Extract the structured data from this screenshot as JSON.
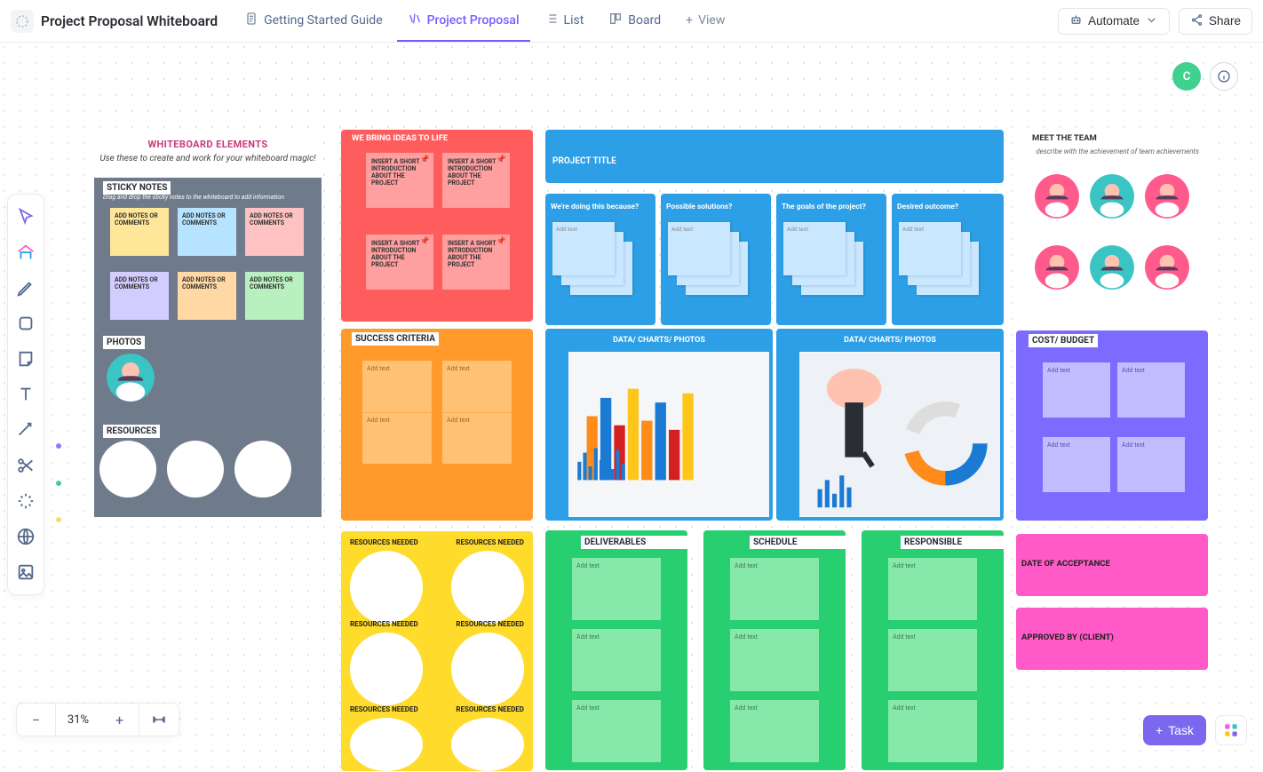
{
  "header": {
    "title": "Project Proposal Whiteboard",
    "tabs": [
      {
        "icon": "doc",
        "label": "Getting Started Guide"
      },
      {
        "icon": "wb",
        "label": "Project Proposal",
        "active": true
      },
      {
        "icon": "list",
        "label": "List"
      },
      {
        "icon": "board",
        "label": "Board"
      }
    ],
    "add_view": "View",
    "automate": "Automate",
    "share": "Share"
  },
  "presence": {
    "user_initial": "C"
  },
  "zoom": {
    "value": "31%"
  },
  "task_button": "Task",
  "elements_panel": {
    "title": "WHITEBOARD ELEMENTS",
    "subtitle": "Use these to create and work for your whiteboard magic!",
    "sticky_label": "STICKY NOTES",
    "sticky_hint": "Drag and drop the sticky notes to the whiteboard to add information",
    "note_text": "ADD NOTES OR COMMENTS",
    "photos_label": "PHOTOS",
    "resources_label": "RESOURCES"
  },
  "ideas": {
    "title": "WE BRING IDEAS TO LIFE",
    "note_text": "INSERT A SHORT INTRODUCTION ABOUT THE PROJECT"
  },
  "project_title": {
    "label": "PROJECT TITLE"
  },
  "questions": [
    {
      "q": "We're doing this because?",
      "ph": "Add text"
    },
    {
      "q": "Possible solutions?",
      "ph": "Add text"
    },
    {
      "q": "The goals of the project?",
      "ph": "Add text"
    },
    {
      "q": "Desired outcome?",
      "ph": "Add text"
    }
  ],
  "success": {
    "title": "SUCCESS CRITERIA",
    "ph": "Add text"
  },
  "data_charts": {
    "title": "DATA/ CHARTS/ PHOTOS"
  },
  "resources": {
    "label": "RESOURCES NEEDED"
  },
  "gcols": [
    {
      "title": "DELIVERABLES",
      "ph": "Add text"
    },
    {
      "title": "SCHEDULE",
      "ph": "Add text"
    },
    {
      "title": "RESPONSIBLE",
      "ph": "Add text"
    }
  ],
  "team": {
    "title": "MEET THE TEAM",
    "subtitle": "describe with the achievement of team achievements"
  },
  "cost": {
    "title": "COST/ BUDGET",
    "ph": "Add text"
  },
  "pink": [
    "DATE OF ACCEPTANCE",
    "APPROVED BY (CLIENT)"
  ]
}
